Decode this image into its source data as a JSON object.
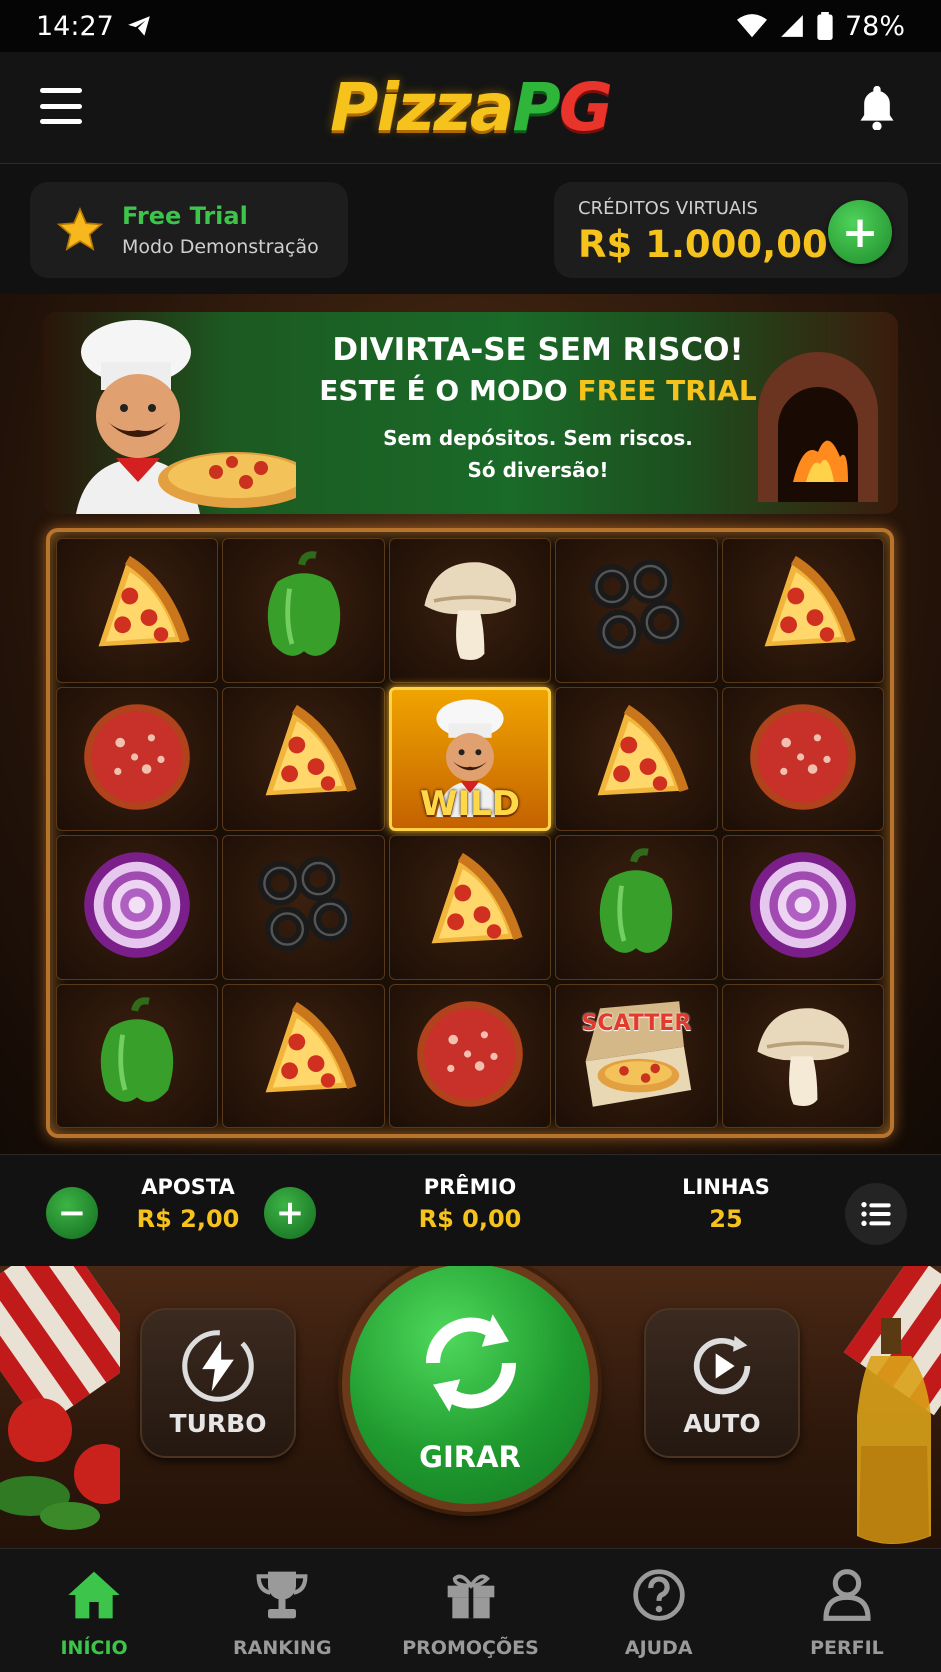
{
  "status_bar": {
    "time": "14:27",
    "battery": "78%"
  },
  "header": {
    "logo_pizza": "Pizza",
    "logo_p": "P",
    "logo_g": "G"
  },
  "trial": {
    "title": "Free Trial",
    "subtitle": "Modo Demonstração"
  },
  "credits": {
    "label": "CRÉDITOS VIRTUAIS",
    "value": "R$ 1.000,00"
  },
  "banner": {
    "headline": "DIVIRTA-SE SEM RISCO!",
    "subheadline_prefix": "ESTE É O MODO",
    "subheadline_highlight": "FREE TRIAL",
    "line1": "Sem depósitos. Sem riscos.",
    "line2": "Só diversão!"
  },
  "reels": {
    "rows": [
      [
        "pizza-slice",
        "green-pepper",
        "mushroom",
        "black-olives",
        "pizza-slice"
      ],
      [
        "salami",
        "pizza-slice",
        "wild",
        "pizza-slice",
        "salami"
      ],
      [
        "red-onion",
        "black-olives",
        "pizza-slice",
        "green-pepper",
        "red-onion"
      ],
      [
        "green-pepper",
        "pizza-slice",
        "salami",
        "scatter",
        "mushroom"
      ]
    ],
    "wild_label": "WILD",
    "scatter_label": "SCATTER"
  },
  "bet_bar": {
    "aposta_label": "APOSTA",
    "aposta_value": "R$ 2,00",
    "premio_label": "PRÊMIO",
    "premio_value": "R$ 0,00",
    "linhas_label": "LINHAS",
    "linhas_value": "25"
  },
  "controls": {
    "turbo": "TURBO",
    "girar": "GIRAR",
    "auto": "AUTO"
  },
  "nav": [
    {
      "label": "INÍCIO",
      "icon": "home-icon",
      "active": true
    },
    {
      "label": "RANKING",
      "icon": "trophy-icon",
      "active": false
    },
    {
      "label": "PROMOÇÕES",
      "icon": "gift-icon",
      "active": false
    },
    {
      "label": "AJUDA",
      "icon": "help-icon",
      "active": false
    },
    {
      "label": "PERFIL",
      "icon": "profile-icon",
      "active": false
    }
  ],
  "colors": {
    "accent_green": "#3dc44a",
    "gold": "#f6c21c",
    "red": "#e8342b"
  }
}
